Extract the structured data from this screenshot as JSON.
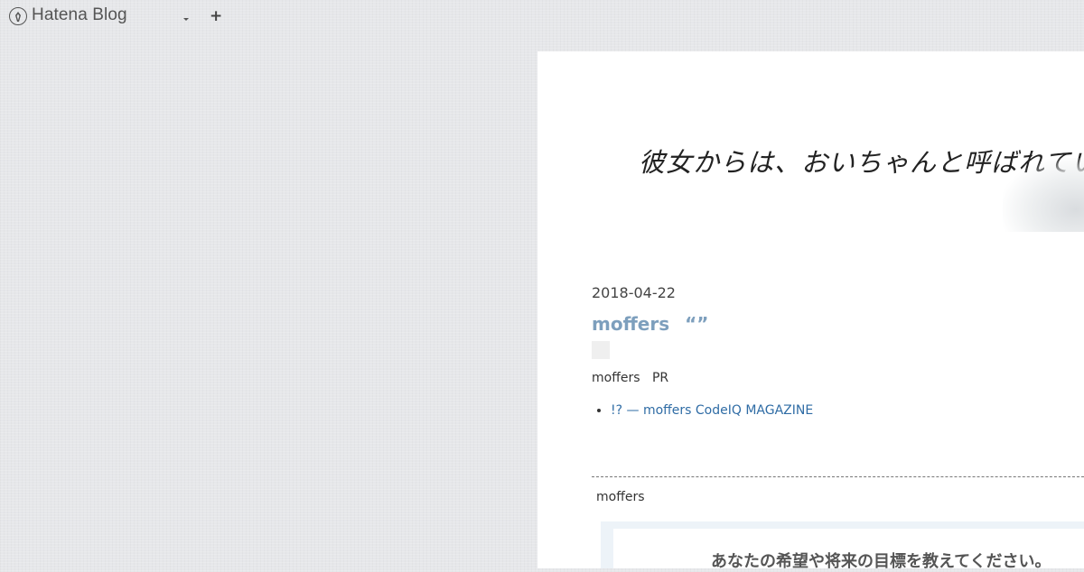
{
  "topbar": {
    "logo_text": "Hatena Blog",
    "dropdown_icon": "caret-down-icon",
    "plus_label": "+"
  },
  "blog": {
    "header_title": "彼女からは、おいちゃんと呼ばれています"
  },
  "post": {
    "date": "2018-04-22",
    "title": "moffers",
    "title_quote": "“”",
    "meta": [
      "moffers",
      "PR"
    ],
    "links": [
      "!? — moffers CodeIQ MAGAZINE"
    ],
    "section_label": "moffers",
    "ad_text": "あなたの希望や将来の目標を教えてください。"
  },
  "colors": {
    "page_background": "#e6e7ea",
    "title_color": "#7d9fbd",
    "link_color": "#2f6ca5"
  }
}
